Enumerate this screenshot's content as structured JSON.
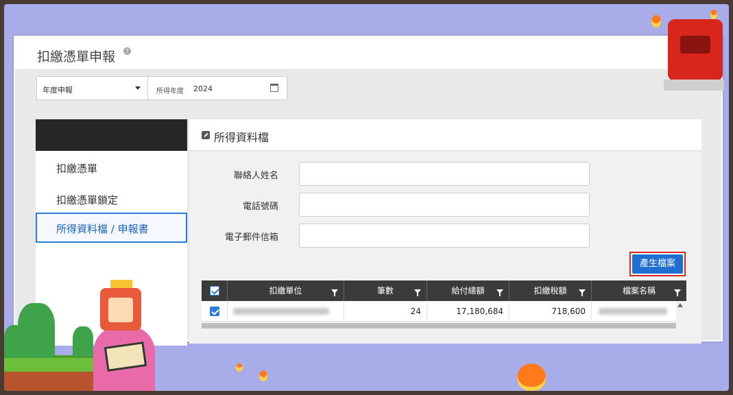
{
  "page": {
    "title": "扣繳憑單申報"
  },
  "filters": {
    "type_select": "年度申報",
    "year_label": "所得年度",
    "year_value": "2024"
  },
  "sidebar": {
    "items": [
      {
        "label": "扣繳憑單",
        "active": false
      },
      {
        "label": "扣繳憑單鎖定",
        "active": false
      },
      {
        "label": "所得資料檔 / 申報書",
        "active": true
      }
    ]
  },
  "main": {
    "section_title": "所得資料檔",
    "form": {
      "contact_name_label": "聯絡人姓名",
      "contact_name_value": "",
      "phone_label": "電話號碼",
      "phone_value": "",
      "email_label": "電子郵件信箱",
      "email_value": ""
    },
    "generate_button": "產生檔案"
  },
  "grid": {
    "columns": [
      "扣繳單位",
      "筆數",
      "給付總額",
      "扣繳稅額",
      "檔案名稱"
    ],
    "rows": [
      {
        "unit": "",
        "count": "24",
        "total_paid": "17,180,684",
        "tax_withheld": "718,600",
        "file_name": ""
      }
    ]
  },
  "colors": {
    "accent": "#1f6fd1",
    "highlight_border": "#d9261c",
    "header_dark": "#262626",
    "active_item": "#2f7bd8"
  },
  "icons": {
    "help": "help-icon",
    "dropdown": "chevron-down-icon",
    "calendar": "calendar-icon",
    "section": "edit-icon",
    "filter": "funnel-icon",
    "checkbox": "checkbox-icon",
    "scroll": "scroll-up-icon"
  }
}
